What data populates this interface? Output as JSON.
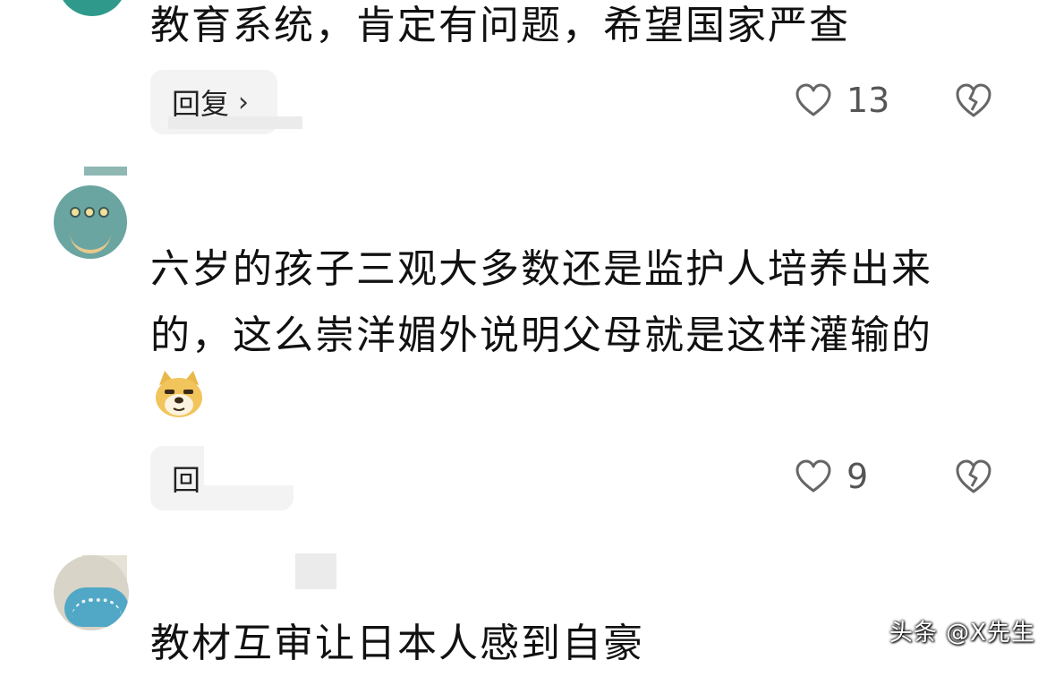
{
  "comments": [
    {
      "text": "教育系统，肯定有问题，希望国家严查",
      "reply_label": "回复",
      "reply_chevron": "›",
      "like_count": "13",
      "like_icon": "heart-outline-icon",
      "dislike_icon": "broken-heart-icon"
    },
    {
      "text": "六岁的孩子三观大多数还是监护人培养出来的，这么崇洋媚外说明父母就是这样灌输的",
      "emoji": "doge-emoji",
      "reply_label": "回",
      "like_count": "9",
      "like_icon": "heart-outline-icon",
      "dislike_icon": "broken-heart-icon"
    },
    {
      "text": "教材互审让日本人感到自豪"
    }
  ],
  "watermark": "头条 @X先生",
  "colors": {
    "text": "#111111",
    "pill_bg": "#f3f3f3",
    "icon": "#666666"
  }
}
